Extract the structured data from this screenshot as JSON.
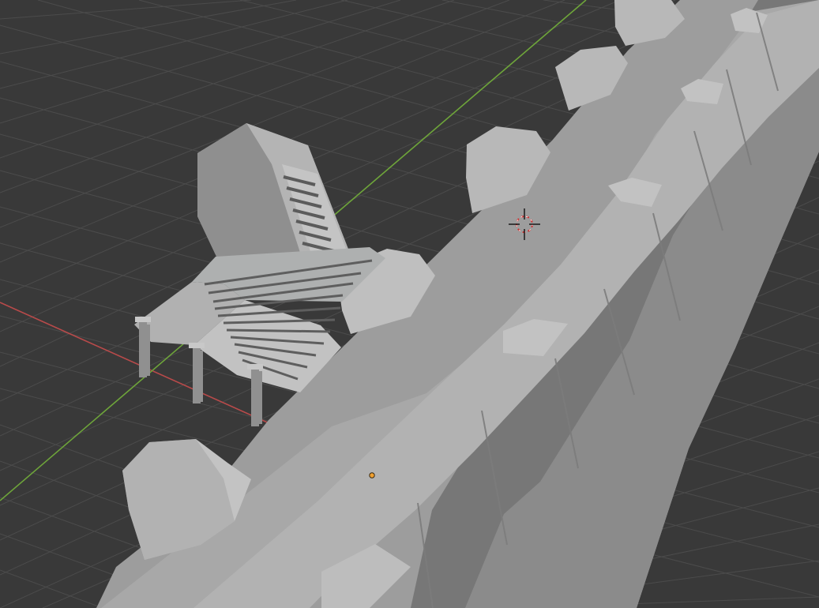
{
  "viewport": {
    "background": "#393939",
    "grid_color": "#555555",
    "x_axis_color": "#b84a4a",
    "y_axis_color": "#6ea53a",
    "mesh_light": "#a9a9a9",
    "mesh_mid": "#8f8f8f",
    "mesh_dark": "#6f6f6f",
    "origin_color": "#f0a030",
    "cursor_colors": [
      "#cc3333",
      "#ffffff",
      "#111111"
    ]
  },
  "icons": {
    "3d_cursor": "3d-cursor-icon",
    "origin": "object-origin-dot-icon"
  }
}
